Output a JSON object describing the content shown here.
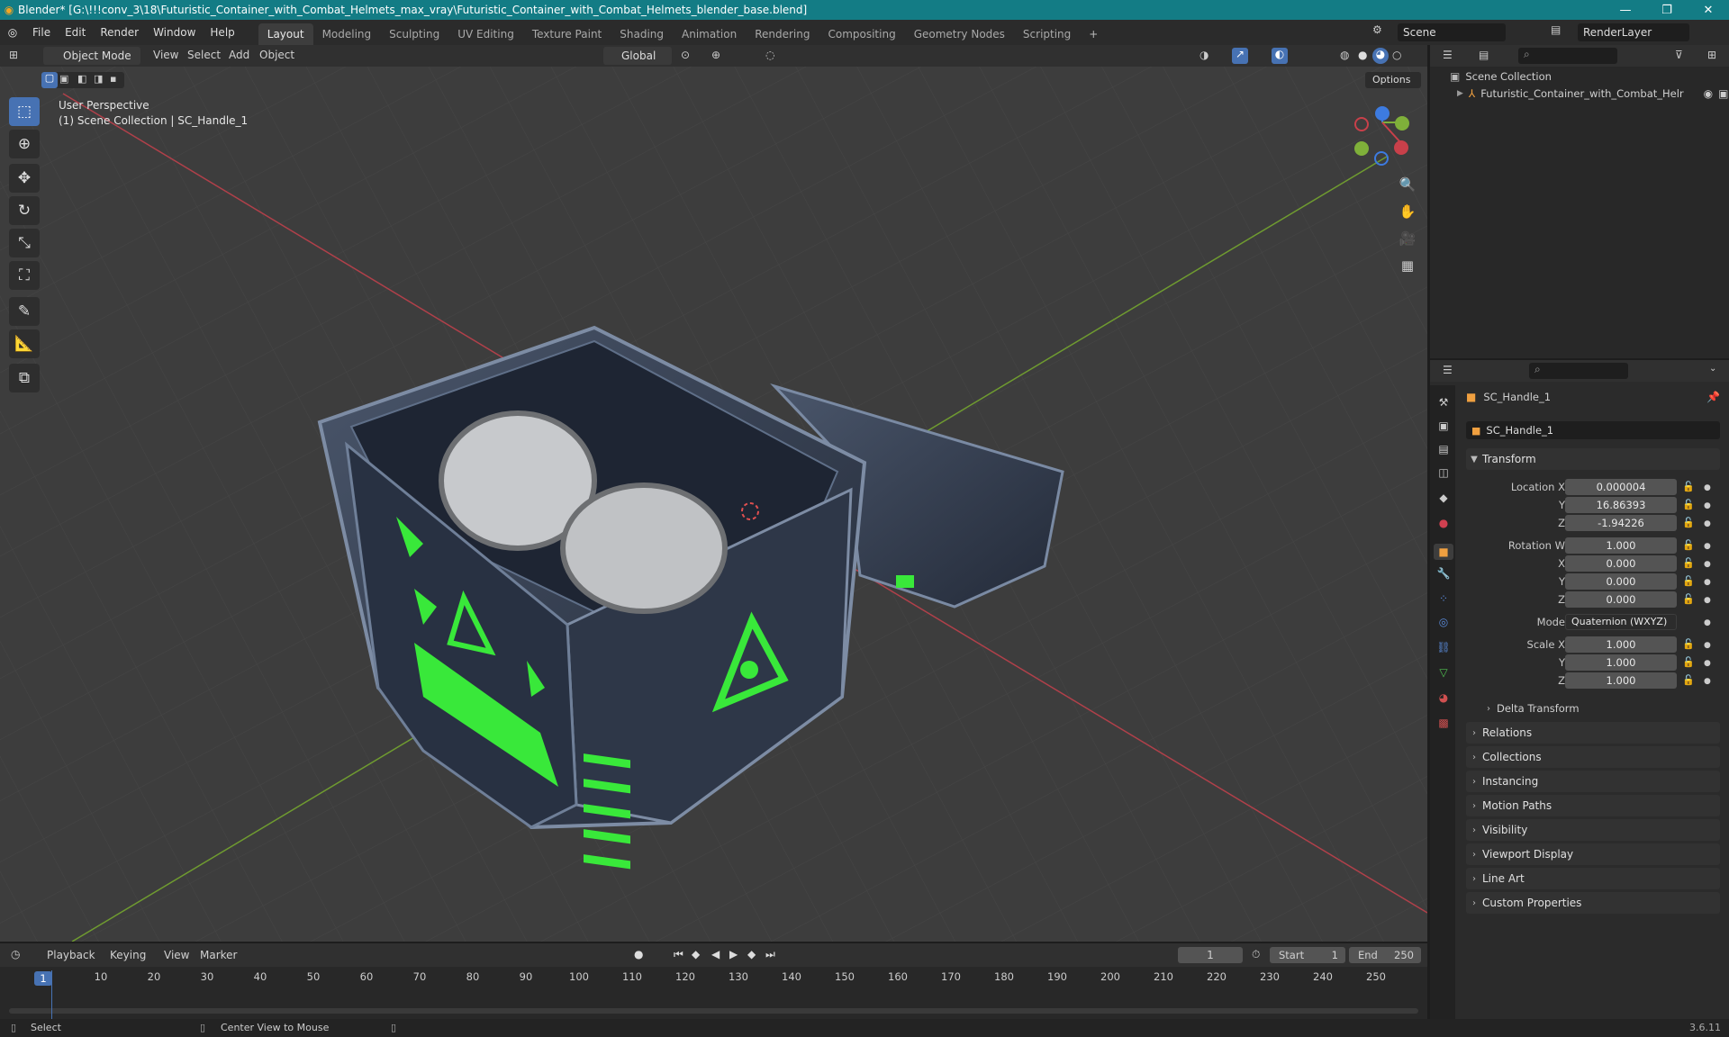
{
  "window": {
    "title": "Blender* [G:\\!!!conv_3\\18\\Futuristic_Container_with_Combat_Helmets_max_vray\\Futuristic_Container_with_Combat_Helmets_blender_base.blend]",
    "minimize": "—",
    "maximize": "❐",
    "close": "✕"
  },
  "menu": [
    "File",
    "Edit",
    "Render",
    "Window",
    "Help"
  ],
  "workspaces": [
    "Layout",
    "Modeling",
    "Sculpting",
    "UV Editing",
    "Texture Paint",
    "Shading",
    "Animation",
    "Rendering",
    "Compositing",
    "Geometry Nodes",
    "Scripting"
  ],
  "workspace_add": "+",
  "scene": {
    "name": "Scene",
    "render_layer": "RenderLayer"
  },
  "viewport_header": {
    "mode": "Object Mode",
    "menus": [
      "View",
      "Select",
      "Add",
      "Object"
    ],
    "orientation": "Global",
    "options": "Options"
  },
  "viewport": {
    "perspective": "User Perspective",
    "collection_info": "(1) Scene Collection | SC_Handle_1",
    "gizmo": {
      "x": "X",
      "y": "Y",
      "z": "Z"
    }
  },
  "outliner": {
    "search_placeholder": "",
    "root": "Scene Collection",
    "items": [
      "Futuristic_Container_with_Combat_Helr"
    ]
  },
  "properties": {
    "object_name": "SC_Handle_1",
    "data_name": "SC_Handle_1",
    "transform_title": "Transform",
    "location": {
      "label": "Location X",
      "x": "0.000004",
      "y": "16.86393",
      "z": "-1.94226"
    },
    "rotation": {
      "label": "Rotation W",
      "w": "1.000",
      "x": "0.000",
      "y": "0.000",
      "z": "0.000"
    },
    "mode_label": "Mode",
    "mode_value": "Quaternion (WXYZ)",
    "scale": {
      "label": "Scale X",
      "x": "1.000",
      "y": "1.000",
      "z": "1.000"
    },
    "axis": {
      "y": "Y",
      "z": "Z",
      "x": "X"
    },
    "delta": "Delta Transform",
    "panels": [
      "Relations",
      "Collections",
      "Instancing",
      "Motion Paths",
      "Visibility",
      "Viewport Display",
      "Line Art",
      "Custom Properties"
    ]
  },
  "timeline": {
    "menus": [
      "Playback",
      "Keying",
      "View",
      "Marker"
    ],
    "current_frame": "1",
    "start_label": "Start",
    "start": "1",
    "end_label": "End",
    "end": "250",
    "ticks": [
      "1",
      "10",
      "20",
      "30",
      "40",
      "50",
      "60",
      "70",
      "80",
      "90",
      "100",
      "110",
      "120",
      "130",
      "140",
      "150",
      "160",
      "170",
      "180",
      "190",
      "200",
      "210",
      "220",
      "230",
      "240",
      "250"
    ]
  },
  "status": {
    "select": "Select",
    "center": "Center View to Mouse",
    "version": "3.6.11"
  },
  "colors": {
    "accent": "#4772b3",
    "titlebar": "#137c85",
    "glow": "#39e83a",
    "xaxis": "#c8404a",
    "yaxis": "#7fb03a",
    "zaxis": "#3d7be0"
  }
}
